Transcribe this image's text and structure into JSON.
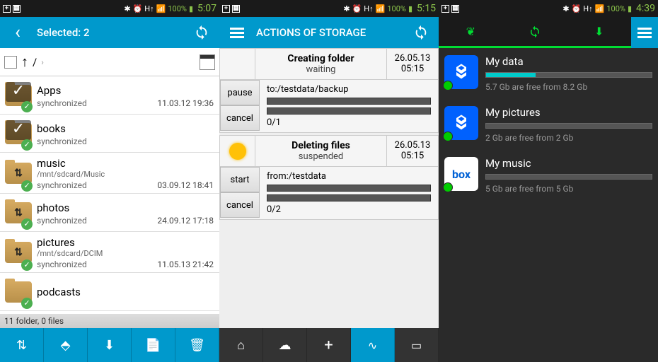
{
  "s1": {
    "status": {
      "battery": "100%",
      "time": "5:07"
    },
    "title": "Selected: 2",
    "path": "/",
    "items": [
      {
        "name": "Apps",
        "type": "<DIR>",
        "path": "",
        "sync": "synchronized",
        "date": "11.03.12 19:36",
        "selected": true,
        "ovl": ""
      },
      {
        "name": "books",
        "type": "",
        "path": "",
        "sync": "synchronized",
        "date": "",
        "selected": true,
        "ovl": ""
      },
      {
        "name": "music",
        "type": "<DIR>",
        "path": "/mnt/sdcard/Music",
        "sync": "synchronized",
        "date": "03.09.12 18:41",
        "selected": false,
        "ovl": "arrows"
      },
      {
        "name": "photos",
        "type": "<DIR>",
        "path": "",
        "sync": "synchronized",
        "date": "24.09.12 17:18",
        "selected": false,
        "ovl": "arrows"
      },
      {
        "name": "pictures",
        "type": "<DIR>",
        "path": "/mnt/sdcard/DCIM",
        "sync": "synchronized",
        "date": "11.05.13 21:42",
        "selected": false,
        "ovl": "arrows"
      },
      {
        "name": "podcasts",
        "type": "<DIR>",
        "path": "",
        "sync": "",
        "date": "",
        "selected": false,
        "ovl": ""
      }
    ],
    "footer": "11 folder, 0 files"
  },
  "s2": {
    "status": {
      "battery": "100%",
      "time": "5:15"
    },
    "title": "ACTIONS OF STORAGE",
    "tasks": [
      {
        "icon": "none",
        "title": "Creating folder",
        "state": "waiting",
        "date": "26.05.13",
        "time": "05:15",
        "btn1": "pause",
        "btn2": "cancel",
        "path": "to:/testdata/backup",
        "count": "0/1"
      },
      {
        "icon": "bulb",
        "title": "Deleting files",
        "state": "suspended",
        "date": "26.05.13",
        "time": "05:15",
        "btn1": "start",
        "btn2": "cancel",
        "path": "from:/testdata",
        "count": "0/2"
      }
    ]
  },
  "s3": {
    "status": {
      "battery": "100%",
      "time": "4:39"
    },
    "accounts": [
      {
        "icon": "dropbox",
        "name": "My data",
        "free": "5.7 Gb are free from 8.2 Gb",
        "pct": 30
      },
      {
        "icon": "dropbox",
        "name": "My pictures",
        "free": "2 Gb are free from 2 Gb",
        "pct": 0
      },
      {
        "icon": "box",
        "name": "My music",
        "free": "5 Gb are free from 5 Gb",
        "pct": 0
      }
    ]
  }
}
